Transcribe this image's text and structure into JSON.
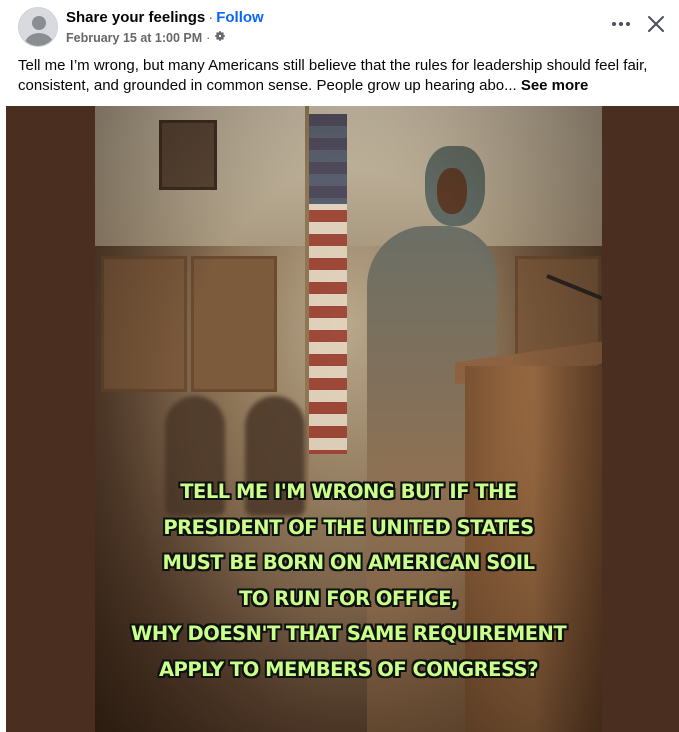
{
  "post": {
    "page_name": "Share your feelings",
    "separator": "·",
    "follow_label": "Follow",
    "timestamp": "February 15 at 1:00 PM",
    "meta_separator": "·",
    "audience_icon": "gear-icon",
    "text": "Tell me I’m wrong, but many Americans still believe that the rules for leadership should feel fair, consistent, and grounded in common sense. People grow up hearing abo...",
    "see_more_label": "See more",
    "more_icon": "more-options-icon",
    "close_icon": "close-icon"
  },
  "image": {
    "caption_lines": [
      "TELL ME I'M WRONG  BUT IF THE",
      "PRESIDENT OF THE UNITED STATES",
      "MUST BE BORN ON AMERICAN SOIL",
      "TO RUN FOR OFFICE,",
      "WHY DOESN'T THAT SAME REQUIREMENT",
      "APPLY TO MEMBERS OF CONGRESS?"
    ]
  },
  "colors": {
    "follow": "#0866ff",
    "caption": "#c9ff8a",
    "media_background": "#4a2e1f"
  }
}
